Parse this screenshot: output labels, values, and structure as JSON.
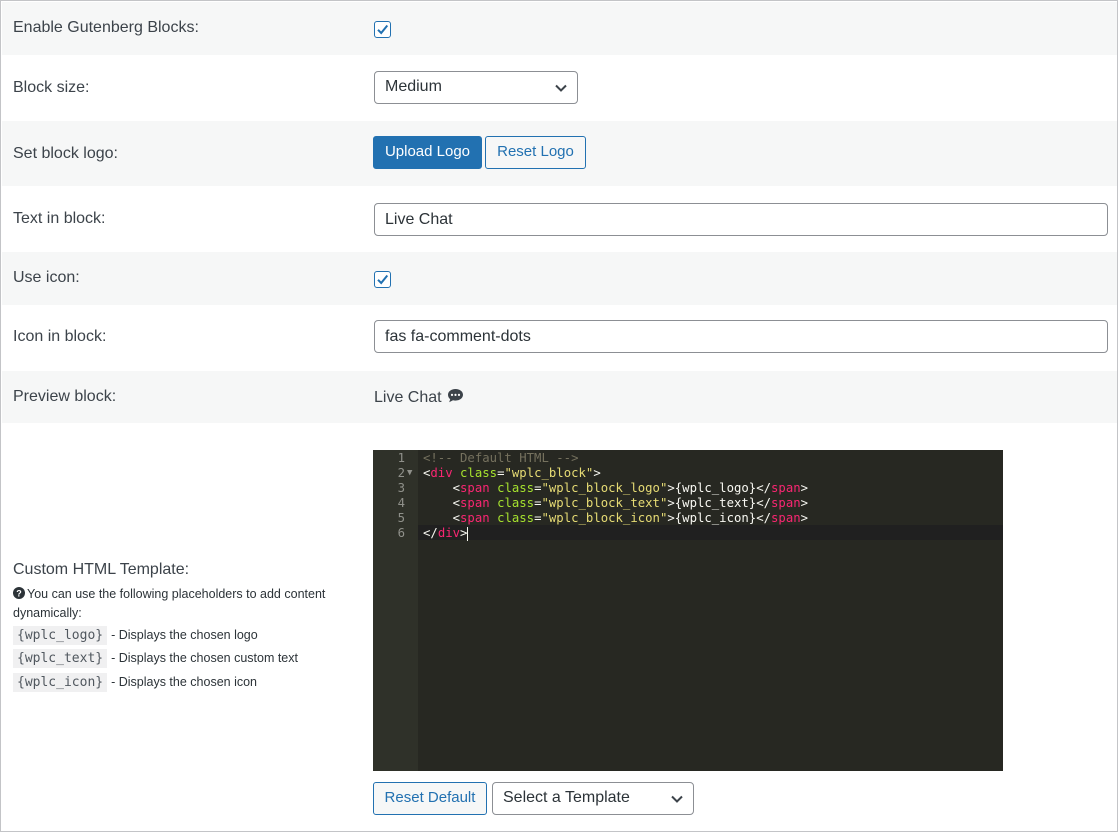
{
  "settings": {
    "enable_gutenberg": {
      "label": "Enable Gutenberg Blocks:",
      "checked": true
    },
    "block_size": {
      "label": "Block size:",
      "value": "Medium"
    },
    "block_logo": {
      "label": "Set block logo:",
      "upload_label": "Upload Logo",
      "reset_label": "Reset Logo"
    },
    "text_in_block": {
      "label": "Text in block:",
      "value": "Live Chat"
    },
    "use_icon": {
      "label": "Use icon:",
      "checked": true
    },
    "icon_in_block": {
      "label": "Icon in block:",
      "value": "fas fa-comment-dots"
    },
    "preview_block": {
      "label": "Preview block:",
      "text": "Live Chat",
      "icon": "comment-dots-icon"
    },
    "custom_html": {
      "label": "Custom HTML Template:",
      "help_text": "You can use the following placeholders to add content dynamically:",
      "help_icon": "question-circle-icon",
      "placeholders": [
        {
          "code": "{wplc_logo}",
          "description": "- Displays the chosen logo"
        },
        {
          "code": "{wplc_text}",
          "description": "- Displays the chosen custom text"
        },
        {
          "code": "{wplc_icon}",
          "description": "- Displays the chosen icon"
        }
      ],
      "reset_default_label": "Reset Default",
      "template_select_value": "Select a Template"
    }
  },
  "editor": {
    "line_numbers": [
      "1",
      "2",
      "3",
      "4",
      "5",
      "6"
    ],
    "lines": [
      "<!-- Default HTML -->",
      "<div class=\"wplc_block\">",
      "    <span class=\"wplc_block_logo\">{wplc_logo}</span>",
      "    <span class=\"wplc_block_text\">{wplc_text}</span>",
      "    <span class=\"wplc_block_icon\">{wplc_icon}</span>",
      "</div>"
    ],
    "line_tokens": {
      "l1": {
        "comment": "<!-- Default HTML -->"
      },
      "l2": {
        "open": "<",
        "tag": "div",
        "sp": " ",
        "attr": "class",
        "eq": "=",
        "str": "\"wplc_block\"",
        "close": ">"
      },
      "l3": {
        "indent": "    ",
        "open": "<",
        "tag": "span",
        "sp": " ",
        "attr": "class",
        "eq": "=",
        "str": "\"wplc_block_logo\"",
        "close": ">",
        "text": "{wplc_logo}",
        "end_open": "</",
        "end_tag": "span",
        "end_close": ">"
      },
      "l4": {
        "indent": "    ",
        "open": "<",
        "tag": "span",
        "sp": " ",
        "attr": "class",
        "eq": "=",
        "str": "\"wplc_block_text\"",
        "close": ">",
        "text": "{wplc_text}",
        "end_open": "</",
        "end_tag": "span",
        "end_close": ">"
      },
      "l5": {
        "indent": "    ",
        "open": "<",
        "tag": "span",
        "sp": " ",
        "attr": "class",
        "eq": "=",
        "str": "\"wplc_block_icon\"",
        "close": ">",
        "text": "{wplc_icon}",
        "end_open": "</",
        "end_tag": "span",
        "end_close": ">"
      },
      "l6": {
        "end_open": "</",
        "end_tag": "div",
        "end_close": ">"
      }
    },
    "colors": {
      "background": "#272822",
      "tag": "#f92672",
      "attr": "#a6e22e",
      "string": "#e6db74",
      "comment": "#75715e"
    }
  },
  "colors": {
    "accent": "#2271b1",
    "row_alt": "#f6f7f7"
  }
}
